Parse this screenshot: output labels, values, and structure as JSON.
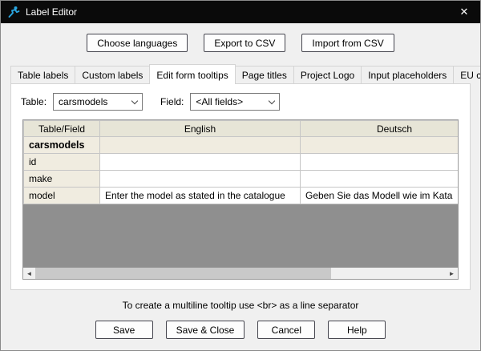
{
  "window": {
    "title": "Label Editor",
    "close_glyph": "✕"
  },
  "colors": {
    "titlebar": "#0a0a0a",
    "grid_header": "#e7e5d7",
    "grid_field_column": "#f0ece0",
    "grid_empty_area": "#8f8f8f",
    "app_icon_blue": "#2aa6e0"
  },
  "toolbar": {
    "buttons": [
      "Choose languages",
      "Export to CSV",
      "Import from CSV"
    ]
  },
  "tabs": {
    "items": [
      "Table labels",
      "Custom labels",
      "Edit form tooltips",
      "Page titles",
      "Project Logo",
      "Input placeholders",
      "EU cookie banner"
    ],
    "active": "Edit form tooltips"
  },
  "filters": {
    "table_label": "Table:",
    "table_value": "carsmodels",
    "field_label": "Field:",
    "field_value": "<All fields>"
  },
  "grid": {
    "headers": [
      "Table/Field",
      "English",
      "Deutsch"
    ],
    "rows": [
      {
        "field": "carsmodels",
        "english": "",
        "deutsch": ""
      },
      {
        "field": "id",
        "english": "",
        "deutsch": ""
      },
      {
        "field": "make",
        "english": "",
        "deutsch": ""
      },
      {
        "field": "model",
        "english": "Enter the model as stated in the catalogue",
        "deutsch": "Geben Sie das Modell wie im Kata"
      }
    ]
  },
  "scrollbar": {
    "left_arrow": "◄",
    "right_arrow": "►"
  },
  "hint": "To create a multiline tooltip use <br> as a line separator",
  "footer": {
    "buttons": [
      "Save",
      "Save & Close",
      "Cancel",
      "Help"
    ]
  }
}
